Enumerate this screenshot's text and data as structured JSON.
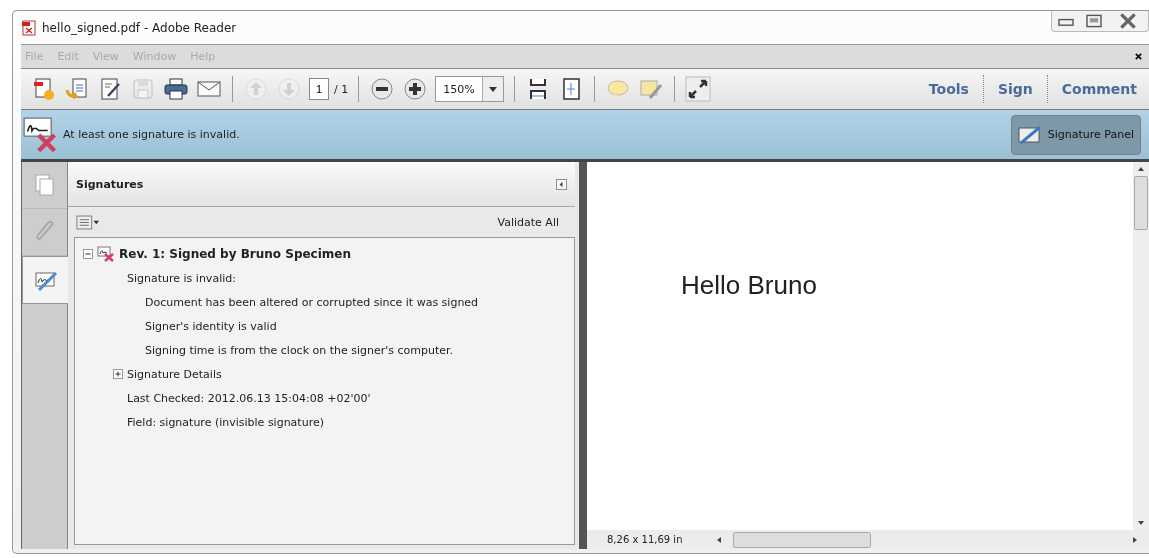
{
  "window": {
    "title": "hello_signed.pdf - Adobe Reader"
  },
  "menu": [
    {
      "label": "File",
      "disabled": true
    },
    {
      "label": "Edit",
      "disabled": true
    },
    {
      "label": "View",
      "disabled": true
    },
    {
      "label": "Window",
      "disabled": true
    },
    {
      "label": "Help",
      "disabled": true
    }
  ],
  "toolbar": {
    "page": {
      "value": "1",
      "total": "/ 1"
    },
    "zoom": {
      "value": "150%"
    },
    "buttons": [
      {
        "kind": "create",
        "disabled": false
      },
      {
        "kind": "open",
        "disabled": false
      },
      {
        "kind": "edit",
        "disabled": false
      },
      {
        "kind": "save",
        "disabled": true
      },
      {
        "kind": "print",
        "disabled": false
      },
      {
        "kind": "mail",
        "disabled": false
      },
      {
        "kind": "sep"
      },
      {
        "kind": "up",
        "disabled": true
      },
      {
        "kind": "down",
        "disabled": true
      },
      {
        "kind": "page"
      },
      {
        "kind": "sep"
      },
      {
        "kind": "zoom-out",
        "disabled": false
      },
      {
        "kind": "zoom-in",
        "disabled": false
      },
      {
        "kind": "zoom"
      },
      {
        "kind": "sep"
      },
      {
        "kind": "fit-width",
        "disabled": false
      },
      {
        "kind": "fit-page",
        "disabled": false
      },
      {
        "kind": "sep"
      },
      {
        "kind": "comment",
        "disabled": false
      },
      {
        "kind": "highlight",
        "disabled": false
      },
      {
        "kind": "sep"
      },
      {
        "kind": "fullscreen",
        "disabled": false
      }
    ],
    "links": [
      "Tools",
      "Sign",
      "Comment"
    ]
  },
  "banner": {
    "message": "At least one signature is invalid.",
    "button": "Signature Panel"
  },
  "side_tabs": [
    {
      "kind": "pages",
      "selected": false
    },
    {
      "kind": "attachments",
      "selected": false
    },
    {
      "kind": "signatures",
      "selected": true
    }
  ],
  "panel": {
    "title": "Signatures",
    "validate_all": "Validate All",
    "tree": [
      {
        "label": "Rev. 1: Signed by Bruno Specimen",
        "kind": "signature",
        "expanded": true,
        "children": [
          {
            "label": "Signature is invalid:",
            "children": [
              {
                "label": "Document has been altered or corrupted since it was signed"
              },
              {
                "label": "Signer's identity is valid"
              },
              {
                "label": "Signing time is from the clock on the signer's computer."
              }
            ]
          },
          {
            "label": "Signature Details",
            "expanded": false
          },
          {
            "label": "Last Checked: 2012.06.13 15:04:08 +02'00'"
          },
          {
            "label": "Field: signature (invisible signature)"
          }
        ]
      }
    ]
  },
  "document": {
    "text": "Hello Bruno",
    "page_size": "8,26 x 11,69 in"
  }
}
